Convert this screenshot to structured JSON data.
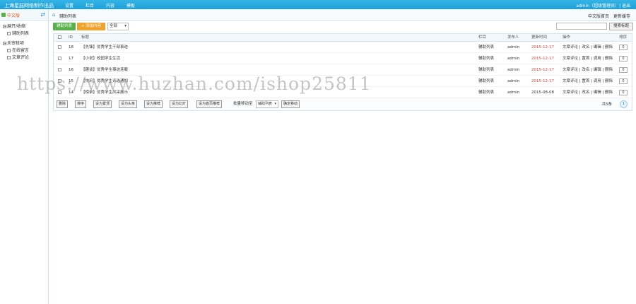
{
  "topbar": {
    "brand": "上海星喆网络制作出品",
    "menu": [
      "设置",
      "栏目",
      "内容",
      "模板"
    ],
    "user": "admin（超级管理员）| 退出"
  },
  "sidebar": {
    "language": "中文版",
    "groups": [
      {
        "label": "展开/收缩",
        "items": [
          "辅助列表"
        ]
      },
      {
        "label": "未审核项",
        "items": [
          "在线留言",
          "文章评论"
        ]
      }
    ]
  },
  "breadcrumb": {
    "title": "辅助列表",
    "right_links": [
      "中文版首页",
      "更新缓存"
    ]
  },
  "toolbar": {
    "list_button": "辅助列表",
    "add_button": "+ 添加内容",
    "filter_value": "全部",
    "search_button": "搜索标题"
  },
  "table": {
    "headers": [
      "ID",
      "标题",
      "栏目",
      "发布人",
      "更新时间",
      "操作",
      "排序"
    ],
    "rows": [
      {
        "id": "18",
        "title": "【先锋】优秀学生干部事迹",
        "column": "辅助列表",
        "author": "admin",
        "date": "2015-12-17",
        "date_red": true,
        "ops": "文章评论 | 改名 | 编辑 | 删除",
        "sort": "0"
      },
      {
        "id": "17",
        "title": "【小说】校园学生生活",
        "column": "辅助列表",
        "author": "admin",
        "date": "2015-12-17",
        "date_red": true,
        "ops": "文章评论 | 置首 | 调用 | 删除",
        "sort": "0"
      },
      {
        "id": "16",
        "title": "【趣谈】优秀学生事迹连载",
        "column": "辅助列表",
        "author": "admin",
        "date": "2015-12-17",
        "date_red": true,
        "ops": "文章评论 | 改名 | 编辑 | 删除",
        "sort": "0"
      },
      {
        "id": "15",
        "title": "【快讯】优秀学生评选通知",
        "column": "辅助列表",
        "author": "admin",
        "date": "2015-12-17",
        "date_red": true,
        "ops": "文章评论 | 置首 | 调用 | 删除",
        "sort": "0"
      },
      {
        "id": "14",
        "title": "【榜单】优秀学生风采展示",
        "column": "辅助列表",
        "author": "admin",
        "date": "2015-08-08",
        "date_red": false,
        "ops": "文章评论 | 改名 | 编辑 | 删除",
        "sort": "0"
      }
    ]
  },
  "footer": {
    "buttons": [
      "删除",
      "排序",
      "设为置顶",
      "设为头条",
      "设为推荐",
      "设为幻灯",
      "设为首页推荐"
    ],
    "batch_label": "批量移动至",
    "batch_select": "辅助列表",
    "batch_button": "确定移动",
    "total": "共5条",
    "page": "1"
  },
  "watermark": "https://www.huzhan.com/ishop25811"
}
